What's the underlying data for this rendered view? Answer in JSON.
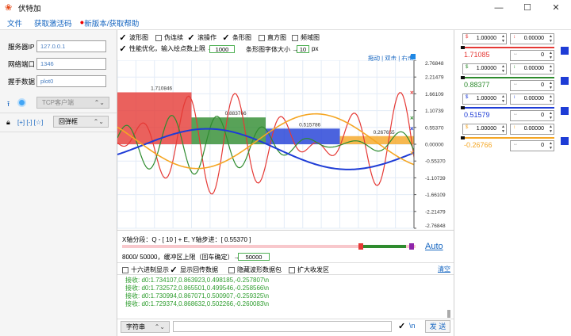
{
  "app": {
    "title": "伏特加"
  },
  "menu": {
    "file": "文件",
    "activate": "获取激活码",
    "dot": "●",
    "help": "新版本/获取帮助"
  },
  "window": {
    "minimize": "—",
    "maximize": "☐",
    "close": "✕"
  },
  "conn": {
    "ip_label": "服务器IP",
    "ip_value": "127.0.0.1",
    "port_label": "网络端口",
    "port_value": "1346",
    "hs_label": "握手数据",
    "hs_value": "plot0",
    "mode": "TCP客户端",
    "brackets": "[+]  [-]  [☆]",
    "popup": "回弹框"
  },
  "plot_opts": {
    "wave": "波形图",
    "pseudo": "伪连续",
    "scroll": "滚操作",
    "bar": "条形图",
    "hist": "直方图",
    "freq": "频域图",
    "perf": "性能优化，输入绘点数上限 →",
    "perf_value": "1000",
    "barfont": "条形图字体大小 →",
    "barfont_value": "10",
    "px": "px"
  },
  "links": {
    "drag": "拖动",
    "dblclick": "双击",
    "rightclick": "右击"
  },
  "y_ticks": [
    "2.76848",
    "2.21479",
    "1.66109",
    "1.10739",
    "0.55370",
    "0.00000",
    "-0.55370",
    "-1.10739",
    "-1.66109",
    "-2.21479",
    "-2.76848"
  ],
  "bar_labels": [
    "1.710846",
    "0.883766",
    "0.515786",
    "0.267655"
  ],
  "axis_info": {
    "text": "X轴分段：Q - [ 10 ] + E,   Y轴步进：[ 0.55370 ]",
    "buffer": "8000/ 50000，缓冲区上限（回车确定）→",
    "buffer_value": "50000",
    "auto": "Auto"
  },
  "recv_opts": {
    "hex": "十六进制显示",
    "show_recv": "显示回传数据",
    "hide_packets": "隐藏波形数据包",
    "expand": "扩大收发区",
    "clear": "清空"
  },
  "recv_lines": [
    "接收: d0:1.734107,0.863923,0.498185,-0.257807\\n",
    "接收: d0:1.732572,0.865501,0.499546,-0.258566\\n",
    "接收: d0:1.730994,0.867071,0.500907,-0.259325\\n",
    "接收: d0:1.729374,0.868632,0.502266,-0.260083\\n"
  ],
  "send": {
    "encoding": "字符串",
    "newline": "\\n",
    "check": "✓",
    "send_btn": "发 送"
  },
  "channels": [
    {
      "scale": "1.00000",
      "offset": "0.00000",
      "value": "1.71085",
      "color": "#e53935",
      "pos": "0"
    },
    {
      "scale": "1.00000",
      "offset": "0.00000",
      "value": "0.88377",
      "color": "#2e8b2e",
      "pos": "0"
    },
    {
      "scale": "1.00000",
      "offset": "0.00000",
      "value": "0.51579",
      "color": "#1e3cd6",
      "pos": "0"
    },
    {
      "scale": "1.00000",
      "offset": "0.00000",
      "value": "-0.26766",
      "color": "#f5a623",
      "pos": "0"
    }
  ],
  "chart_data": {
    "type": "bar",
    "categories": [
      "d0",
      "d1",
      "d2",
      "d3"
    ],
    "values": [
      1.710846,
      0.883766,
      0.515786,
      0.267655
    ],
    "colors": [
      "#e53935",
      "#2e8b2e",
      "#1e3cd6",
      "#f5a623"
    ],
    "ylim": [
      -2.76848,
      2.76848
    ],
    "grid": true
  }
}
